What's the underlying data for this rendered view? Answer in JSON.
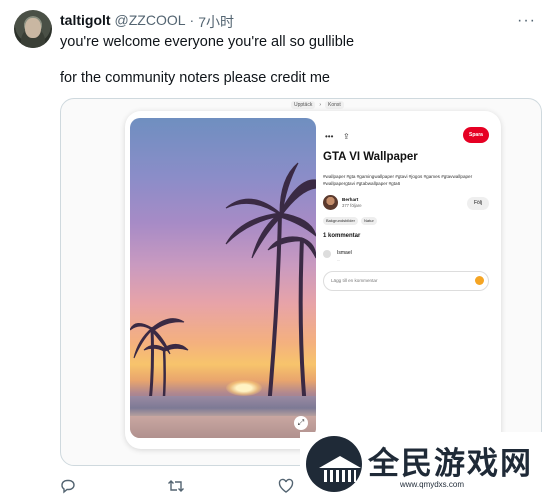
{
  "tweet": {
    "display_name": "taltigolt",
    "handle": "@ZZCOOL",
    "separator": "·",
    "time": "7小时",
    "more_icon": "more-horizontal-icon",
    "lines": [
      "you're welcome everyone you're all so gullible",
      "for the community noters please credit me"
    ]
  },
  "embed": {
    "breadcrumb": [
      "Upptäck",
      "Konst"
    ],
    "pin": {
      "more_label": "•••",
      "share_icon": "upload-icon",
      "save_label": "Spara",
      "title": "GTA VI Wallpaper",
      "tags": "#wallpaper #gta #gamingwallpaper #gtavi #jogos #games #gtavwallpaper #wallpapergtavi #gtabwallpaper #gta6",
      "author_name": "Berhart",
      "author_followers": "377 följare",
      "follow_label": "Följ",
      "chips": [
        "Bakgrundsbilder",
        "Natur"
      ],
      "comments_title": "1 kommentar",
      "comment_user": "Ismael",
      "comment_text": "...",
      "comment_placeholder": "Lägg till en kommentar",
      "expand_icon": "expand-icon"
    }
  },
  "actions": {
    "reply_icon": "reply-icon",
    "retweet_icon": "retweet-icon",
    "like_icon": "heart-icon"
  },
  "watermark": {
    "title": "全民游戏网",
    "url": "www.qmydxs.com"
  }
}
